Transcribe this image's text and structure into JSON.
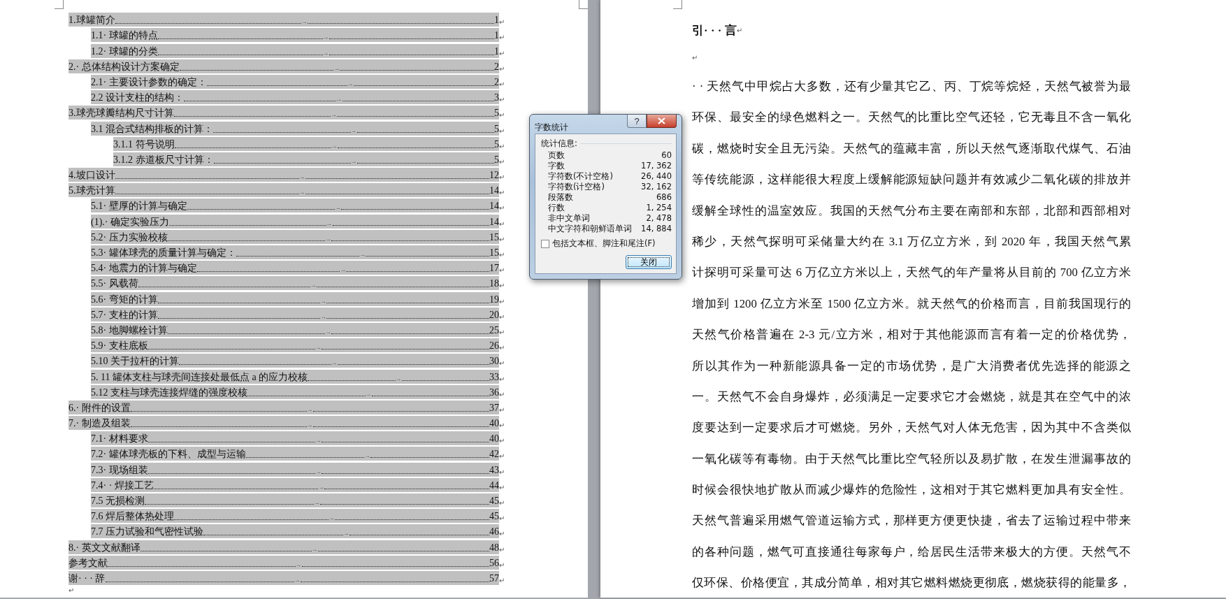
{
  "toc": {
    "entries": [
      {
        "text": "1.球罐简介",
        "tab": "→",
        "page": "1",
        "mark": "↵",
        "children": [
          {
            "text": "1.1· 球罐的特点",
            "tab": "→",
            "page": "1",
            "mark": "↵"
          },
          {
            "text": "1.2· 球罐的分类",
            "tab": "→",
            "page": "1",
            "mark": "↵"
          }
        ]
      },
      {
        "text": "2.· 总体结构设计方案确定",
        "tab": "→",
        "page": "2",
        "mark": "↵",
        "children": [
          {
            "text": "2.1· 主要设计参数的确定：",
            "tab": "→",
            "page": "2",
            "mark": "↵"
          },
          {
            "text": "2.2 设计支柱的结构：",
            "tab": "→",
            "page": "3",
            "mark": "↵"
          }
        ]
      },
      {
        "text": "3.球壳球瓣结构尺寸计算",
        "tab": "→",
        "page": "5",
        "mark": "↵",
        "children": [
          {
            "text": "3.1 混合式结构排板的计算：",
            "tab": "→",
            "page": "5",
            "mark": "↵",
            "children": [
              {
                "text": "3.1.1 符号说明",
                "tab": "→",
                "page": "5",
                "mark": "↵"
              },
              {
                "text": "3.1.2 赤道板尺寸计算：",
                "tab": "→",
                "page": "5",
                "mark": "↵"
              }
            ]
          }
        ]
      },
      {
        "text": "4.坡口设计",
        "tab": "→",
        "page": "12",
        "mark": "↵"
      },
      {
        "text": "5.球壳计算",
        "tab": "→",
        "page": "14",
        "mark": "↵",
        "children": [
          {
            "text": "5.1· 壁厚的计算与确定",
            "tab": "→",
            "page": "14",
            "mark": "↵"
          },
          {
            "text": "(1).· 确定实验压力",
            "tab": "→",
            "page": "14",
            "mark": "↵"
          },
          {
            "text": "5.2· 压力实验校核",
            "tab": "→",
            "page": "15",
            "mark": "↵"
          },
          {
            "text": "5.3· 罐体球壳的质量计算与确定：",
            "tab": "→",
            "page": "15",
            "mark": "↵"
          },
          {
            "text": "5.4· 地震力的计算与确定",
            "tab": "→",
            "page": "17",
            "mark": "↵"
          },
          {
            "text": "5.5· 风载荷",
            "tab": "→",
            "page": "18",
            "mark": "↵"
          },
          {
            "text": "5.6· 弯矩的计算",
            "tab": "→",
            "page": "19",
            "mark": "↵"
          },
          {
            "text": "5.7· 支柱的计算",
            "tab": "→",
            "page": "20",
            "mark": "↵"
          },
          {
            "text": "5.8· 地脚螺栓计算",
            "tab": "→",
            "page": "25",
            "mark": "↵"
          },
          {
            "text": "5.9· 支柱底板",
            "tab": "→",
            "page": "26",
            "mark": "↵"
          },
          {
            "text": "5.10 关于拉杆的计算",
            "tab": "→",
            "page": "30",
            "mark": "↵"
          },
          {
            "text": "5. 11 罐体支柱与球壳间连接处最低点 a 的应力校核",
            "tab": "→",
            "page": "33",
            "mark": "↵"
          },
          {
            "text": "5.12 支柱与球壳连接焊缝的强度校核",
            "tab": "→",
            "page": "36",
            "mark": "↵"
          }
        ]
      },
      {
        "text": "6.· 附件的设置",
        "tab": "→",
        "page": "37",
        "mark": "↵"
      },
      {
        "text": "7.· 制造及组装",
        "tab": "→",
        "page": "40",
        "mark": "↵",
        "children": [
          {
            "text": "7.1· 材料要求",
            "tab": "→",
            "page": "40",
            "mark": "↵"
          },
          {
            "text": "7.2· 罐体球壳板的下料、成型与运输",
            "tab": "→",
            "page": "42",
            "mark": "↵"
          },
          {
            "text": "7.3· 现场组装",
            "tab": "→",
            "page": "43",
            "mark": "↵"
          },
          {
            "text": "7.4· · 焊接工艺",
            "tab": "→",
            "page": "44",
            "mark": "↵"
          },
          {
            "text": "7.5 无损检测",
            "tab": "→",
            "page": "45",
            "mark": "↵"
          },
          {
            "text": "7.6 焊后整体热处理",
            "tab": "→",
            "page": "45",
            "mark": "↵"
          },
          {
            "text": "7.7 压力试验和气密性试验",
            "tab": "→",
            "page": "46",
            "mark": "↵"
          }
        ]
      },
      {
        "text": "8.· 英文文献翻译",
        "tab": "→",
        "page": "48",
        "mark": "↵"
      },
      {
        "text": "参考文献",
        "tab": "→",
        "page": "56",
        "mark": "↵"
      },
      {
        "text": "谢· · · 辞",
        "tab": "→",
        "page": "57",
        "mark": "↵"
      }
    ],
    "end_mark": "↵"
  },
  "dialog": {
    "title": "字数统计",
    "help": "?",
    "section": "统计信息:",
    "stats": [
      {
        "label": "页数",
        "value": "60"
      },
      {
        "label": "字数",
        "value": "17, 362"
      },
      {
        "label": "字符数(不计空格)",
        "value": "26, 440"
      },
      {
        "label": "字符数(计空格)",
        "value": "32, 162"
      },
      {
        "label": "段落数",
        "value": "686"
      },
      {
        "label": "行数",
        "value": "1, 254"
      },
      {
        "label": "非中文单词",
        "value": "2, 478"
      },
      {
        "label": "中文字符和朝鲜语单词",
        "value": "14, 884"
      }
    ],
    "checkbox": {
      "label": "包括文本框、脚注和尾注(F)",
      "checked": false
    },
    "button": "关闭"
  },
  "page": {
    "heading": "引· · · 言",
    "heading_mark": "↵",
    "blank_mark": "↵",
    "lines": [
      "· · 天然气中甲烷占大多数，还有少量其它乙、丙、丁烷等烷烃，天然气被誉为最",
      "环保、最安全的绿色燃料之一。天然气的比重比空气还轻，它无毒且不含一氧化",
      "碳，燃烧时安全且无污染。天然气的蕴藏丰富，所以天然气逐渐取代煤气、石油",
      "等传统能源，这样能很大程度上缓解能源短缺问题并有效减少二氧化碳的排放并",
      "缓解全球性的温室效应。我国的天然气分布主要在南部和东部，北部和西部相对",
      "稀少，天然气探明可采储量大约在 3.1 万亿立方米，到 2020 年，我国天然气累",
      "计探明可采量可达 6 万亿立方米以上，天然气的年产量将从目前的 700 亿立方米",
      "增加到 1200 亿立方米至 1500 亿立方米。就天然气的价格而言，目前我国现行的",
      "天然气价格普遍在 2-3 元/立方米，相对于其他能源而言有着一定的价格优势，",
      "所以其作为一种新能源具备一定的市场优势，是广大消费者优先选择的能源之",
      "一。天然气不会自身爆炸，必须满足一定要求它才会燃烧，就是其在空气中的浓",
      "度要达到一定要求后才可燃烧。另外，天然气对人体无危害，因为其中不含类似",
      "一氧化碳等有毒物。由于天然气比重比空气轻所以及易扩散，在发生泄漏事故的",
      "时候会很快地扩散从而减少爆炸的危险性，这相对于其它燃料更加具有安全性。",
      "天然气普遍采用燃气管道运输方式，那样更方便更快捷，省去了运输过程中带来",
      "的各种问题，燃气可直接通往每家每户，给居民生活带来极大的方便。天然气不",
      "仅环保、价格便宜，其成分简单，相对其它燃料燃烧更彻底，燃烧获得的能量多，"
    ]
  }
}
